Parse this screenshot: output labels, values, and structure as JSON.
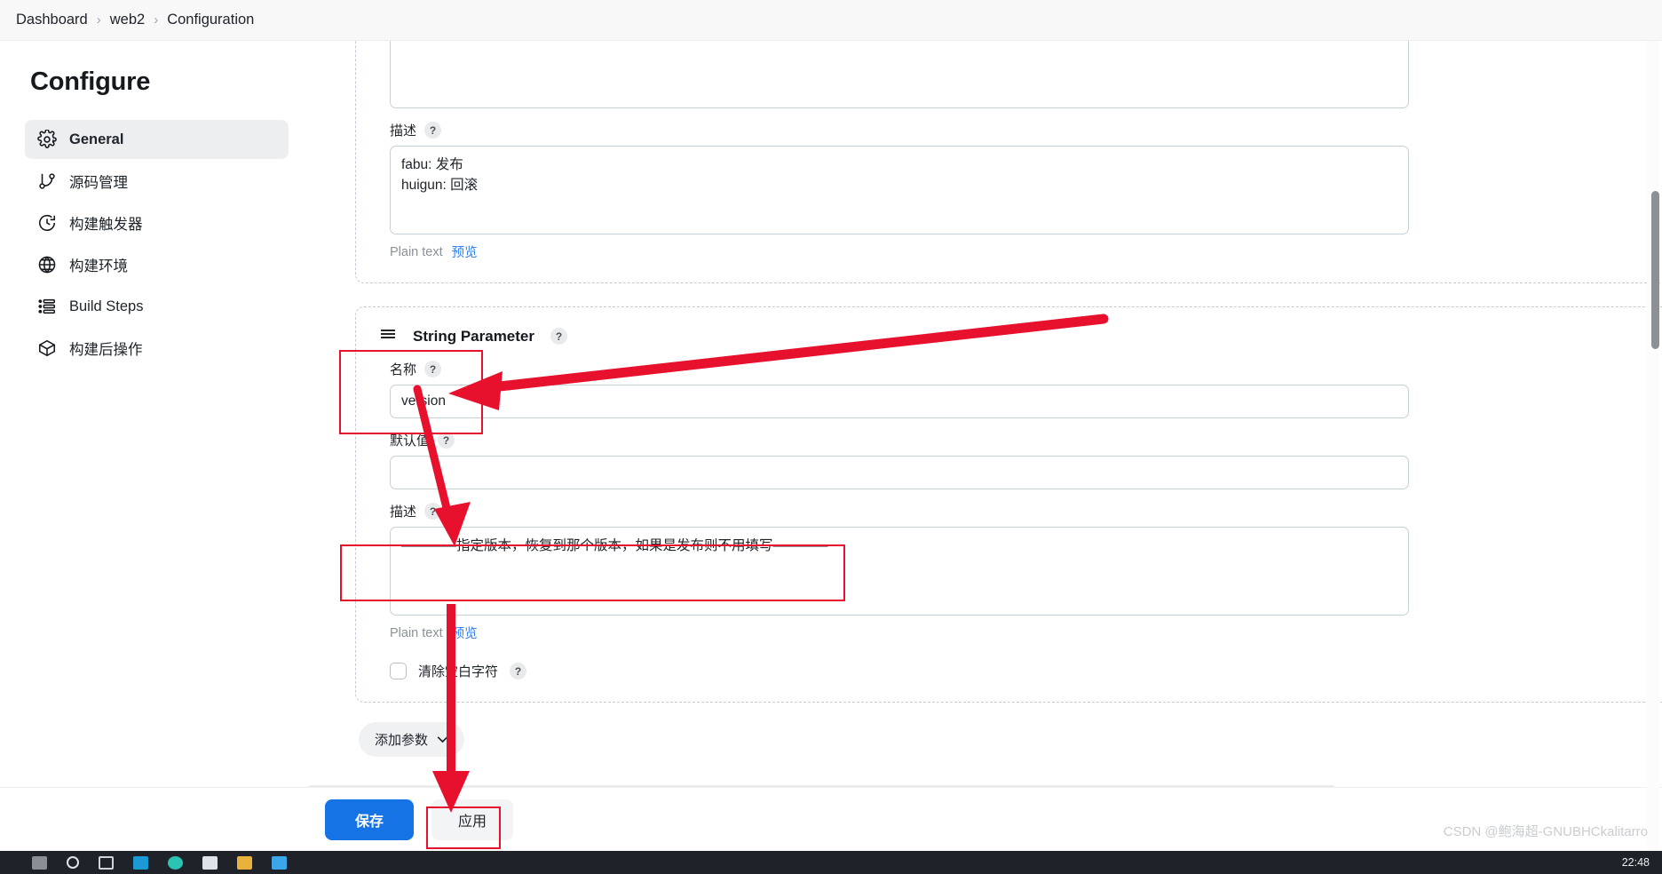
{
  "breadcrumb": {
    "items": [
      "Dashboard",
      "web2",
      "Configuration"
    ],
    "separator": "›"
  },
  "sidebar": {
    "title": "Configure",
    "items": [
      {
        "label": "General",
        "icon": "gear-icon",
        "active": true
      },
      {
        "label": "源码管理",
        "icon": "git-branch-icon",
        "active": false
      },
      {
        "label": "构建触发器",
        "icon": "clock-icon",
        "active": false
      },
      {
        "label": "构建环境",
        "icon": "globe-icon",
        "active": false
      },
      {
        "label": "Build Steps",
        "icon": "list-icon",
        "active": false
      },
      {
        "label": "构建后操作",
        "icon": "package-icon",
        "active": false
      }
    ]
  },
  "form": {
    "top_block": {
      "textarea_top_value": "",
      "description_label": "描述",
      "description_value": "fabu: 发布\nhuigun: 回滚",
      "plain_text_label": "Plain text",
      "preview_link": "预览",
      "help": "?"
    },
    "string_parameter": {
      "title": "String Parameter",
      "help": "?",
      "drag_handle": "drag-handle-icon",
      "close": "✕",
      "name_label": "名称",
      "name_value": "version",
      "default_label": "默认值",
      "default_value": "",
      "description_label": "描述",
      "description_value": "————指定版本，恢复到那个版本，如果是发布则不用填写————",
      "plain_text_label": "Plain text",
      "preview_link": "预览",
      "trim_label": "清除空白字符",
      "trim_checked": false
    },
    "add_parameter_button": "添加参数",
    "add_parameter_chevron": "chevron-down-icon"
  },
  "actions": {
    "save_label": "保存",
    "apply_label": "应用"
  },
  "watermark": "CSDN @鲍海超-GNUBHCkalitarro",
  "taskbar": {
    "clock": "22:48"
  },
  "colors": {
    "accent_blue": "#1573e6",
    "link_blue": "#2d7ff9",
    "annotation_red": "#e8112d",
    "close_red": "#e8112d",
    "sidebar_active": "#eceef0"
  }
}
